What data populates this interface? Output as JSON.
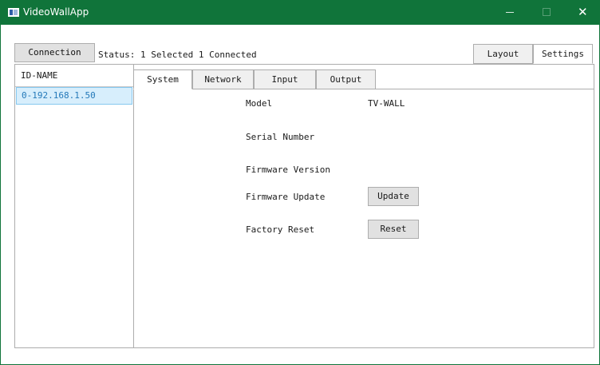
{
  "window": {
    "title": "VideoWallApp",
    "accent_color": "#10743a",
    "icons": {
      "app": "app-window-icon",
      "minimize": "minimize-icon",
      "maximize": "maximize-icon",
      "close": "close-icon"
    },
    "close_glyph": "✕"
  },
  "toolbar": {
    "connection_label": "Connection",
    "status_text": "Status: 1 Selected 1 Connected"
  },
  "view_tabs": [
    {
      "label": "Layout",
      "selected": false
    },
    {
      "label": "Settings",
      "selected": true
    }
  ],
  "device_list": {
    "header": "ID-NAME",
    "items": [
      {
        "label": "0-192.168.1.50",
        "selected": true
      }
    ],
    "selected_color": "#d7eefc"
  },
  "settings_tabs": [
    {
      "label": "System",
      "selected": true
    },
    {
      "label": "Network",
      "selected": false
    },
    {
      "label": "Input",
      "selected": false
    },
    {
      "label": "Output",
      "selected": false
    }
  ],
  "system": {
    "model_label": "Model",
    "model_value": "TV-WALL",
    "serial_label": "Serial Number",
    "firmware_version_label": "Firmware Version",
    "firmware_update_label": "Firmware Update",
    "update_button": "Update",
    "factory_reset_label": "Factory Reset",
    "reset_button": "Reset"
  }
}
